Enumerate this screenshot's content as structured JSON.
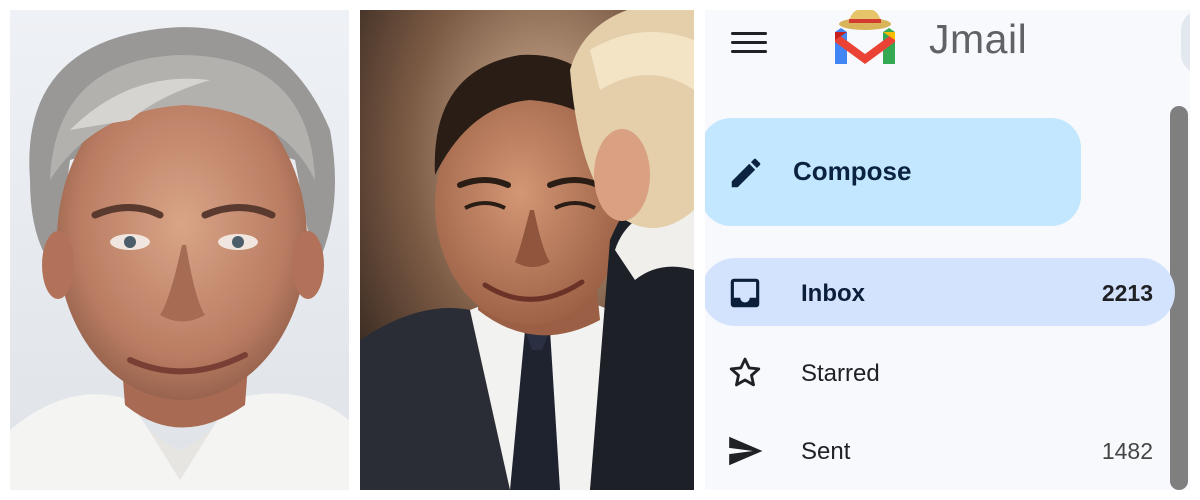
{
  "mail": {
    "brand": "Jmail",
    "compose_label": "Compose",
    "nav": [
      {
        "label": "Inbox",
        "count": "2213",
        "icon": "inbox-icon"
      },
      {
        "label": "Starred",
        "count": "",
        "icon": "star-icon"
      },
      {
        "label": "Sent",
        "count": "1482",
        "icon": "send-icon"
      }
    ]
  },
  "colors": {
    "compose_bg": "#c2e7ff",
    "active_nav_bg": "#d3e3fd",
    "panel_bg": "#f7f9fc"
  }
}
